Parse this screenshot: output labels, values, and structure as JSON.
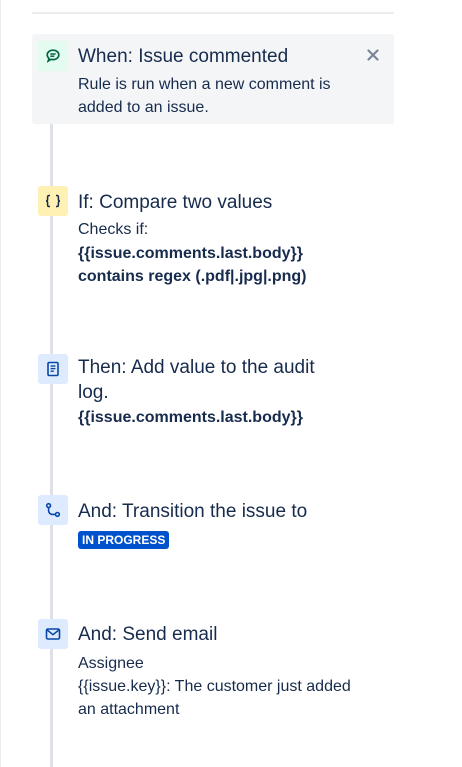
{
  "trigger": {
    "title": "When: Issue commented",
    "description_line1": "Rule is run when a new comment is",
    "description_line2": "added to an issue.",
    "close_symbol": "×",
    "icon": "comment-icon"
  },
  "condition": {
    "title": "If: Compare two values",
    "label": "Checks if:",
    "value_line1": "{{issue.comments.last.body}}",
    "value_line2": "contains regex (.pdf|.jpg|.png)",
    "icon": "curly-braces-icon"
  },
  "action_audit": {
    "title_line1": "Then: Add value to the audit",
    "title_line2": "log.",
    "value": "{{issue.comments.last.body}}",
    "icon": "audit-log-icon"
  },
  "action_transition": {
    "title": "And: Transition the issue to",
    "status": "IN PROGRESS",
    "status_color": "#0052cc",
    "icon": "transition-icon"
  },
  "action_email": {
    "title": "And: Send email",
    "recipient": "Assignee",
    "subject_line1": "{{issue.key}}: The customer just added",
    "subject_line2": "an attachment",
    "icon": "envelope-icon"
  },
  "colors": {
    "trigger_icon_bg": "#e3fcef",
    "condition_icon_bg": "#fff0b3",
    "action_icon_bg": "#deebff",
    "card_bg": "#f4f5f7",
    "text": "#172b4d"
  }
}
